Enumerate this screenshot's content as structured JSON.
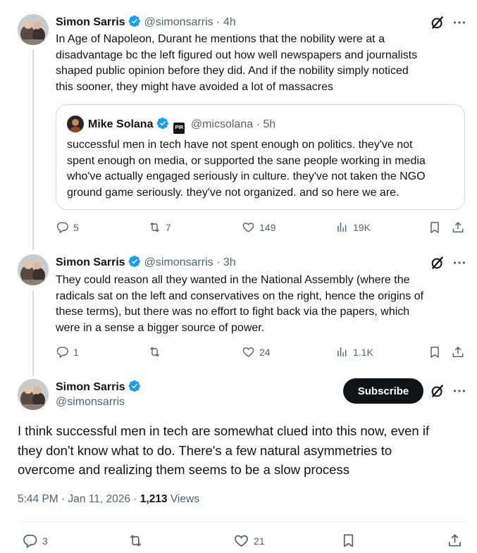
{
  "colors": {
    "verified": "#1d9bf0",
    "text": "#0f1419",
    "secondary": "#536471",
    "subscribe_bg": "#0f1419"
  },
  "tweets": [
    {
      "name": "Simon Sarris",
      "handle": "@simonsarris",
      "time": "· 4h",
      "lines": [
        "In Age of Napoleon, Durant he mentions that the nobility were at a",
        "disadvantage bc the left figured out how well newspapers and journalists",
        "shaped public opinion before they did. And if the nobility simply noticed",
        "this sooner, they might have avoided a lot of massacres"
      ],
      "quote": {
        "name": "Mike Solana",
        "badge": "PIR",
        "handle": "@micsolana",
        "time": "· 5h",
        "lines": [
          "successful men in tech have not spent enough on politics. they've not",
          "spent enough on media, or supported the sane people working in media",
          "who've actually engaged seriously in culture. they've not taken the NGO",
          "ground game seriously. they've not organized. and so here we are."
        ]
      },
      "stats": {
        "replies": "5",
        "reposts": "7",
        "likes": "149",
        "views": "19K"
      }
    },
    {
      "name": "Simon Sarris",
      "handle": "@simonsarris",
      "time": "· 3h",
      "lines": [
        "They could reason all they wanted in the National Assembly (where the",
        "radicals sat on the left and conservatives on the right, hence the origins of",
        "these terms), but there was no effort to fight back via the papers, which",
        "were in a sense a bigger source of power."
      ],
      "stats": {
        "replies": "1",
        "reposts": "",
        "likes": "24",
        "views": "1.1K"
      }
    }
  ],
  "main": {
    "name": "Simon Sarris",
    "handle": "@simonsarris",
    "subscribe_label": "Subscribe",
    "lines": [
      "I think successful men in tech are somewhat clued into this now, even if",
      "they don't know what to do. There's a few natural asymmetries to",
      "overcome and realizing them seems to be a slow process"
    ],
    "timestamp": "5:44 PM · Jan 11, 2026 ·",
    "views_count": "1,213",
    "views_label": "Views",
    "stats": {
      "replies": "3",
      "reposts": "",
      "likes": "21"
    }
  },
  "icons": {
    "reply": "reply-icon",
    "repost": "repost-icon",
    "like": "heart-icon",
    "views": "views-icon",
    "bookmark": "bookmark-icon",
    "share": "share-icon",
    "grok": "grok-icon",
    "more": "more-icon",
    "verified": "verified-badge-icon"
  }
}
